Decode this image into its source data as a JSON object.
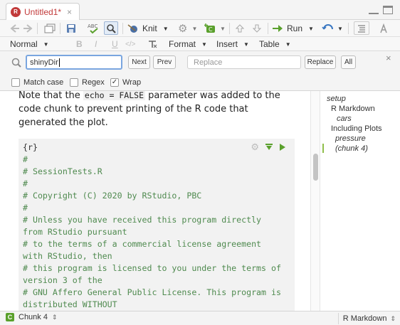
{
  "tab": {
    "title": "Untitled1*",
    "close": "×"
  },
  "toolbar": {
    "knit_label": "Knit",
    "run_label": "Run",
    "spell_label": "ABC"
  },
  "formatbar": {
    "mode": "Normal",
    "bold": "B",
    "italic": "I",
    "underline": "U",
    "code": "</>",
    "format": "Format",
    "insert": "Insert",
    "table": "Table"
  },
  "find": {
    "value": "shinyDir",
    "next": "Next",
    "prev": "Prev",
    "replace_placeholder": "Replace",
    "replace_btn": "Replace",
    "all_btn": "All",
    "match_case": "Match case",
    "regex": "Regex",
    "wrap": "Wrap",
    "wrap_checked": true,
    "close": "×"
  },
  "editor": {
    "prose": {
      "line1_pre": "Note that the ",
      "code": "echo = FALSE",
      "line1_post": " parameter was added to the",
      "line2": "code chunk to prevent printing of the R code that",
      "line3": "generated the plot."
    },
    "chunk_header": "{r}",
    "code_lines": [
      "#",
      "# SessionTests.R",
      "#",
      "# Copyright (C) 2020 by RStudio, PBC",
      "#",
      "# Unless you have received this program directly",
      "from RStudio pursuant",
      "# to the terms of a commercial license agreement",
      "with RStudio, then",
      "# this program is licensed to you under the terms of",
      "version 3 of the",
      "# GNU Affero General Public License. This program is",
      "distributed WITHOUT"
    ]
  },
  "outline": {
    "items": [
      {
        "label": "setup"
      },
      {
        "label": "R Markdown"
      },
      {
        "label": "cars"
      },
      {
        "label": "Including Plots"
      },
      {
        "label": "pressure"
      },
      {
        "label": "(chunk 4)"
      }
    ]
  },
  "status": {
    "badge": "C",
    "chunk": "Chunk 4",
    "mode": "R Markdown"
  },
  "colors": {
    "accent": "#c23a3a",
    "code_comment": "#4f8a4f",
    "chunk_bg": "#f2f2f2"
  }
}
